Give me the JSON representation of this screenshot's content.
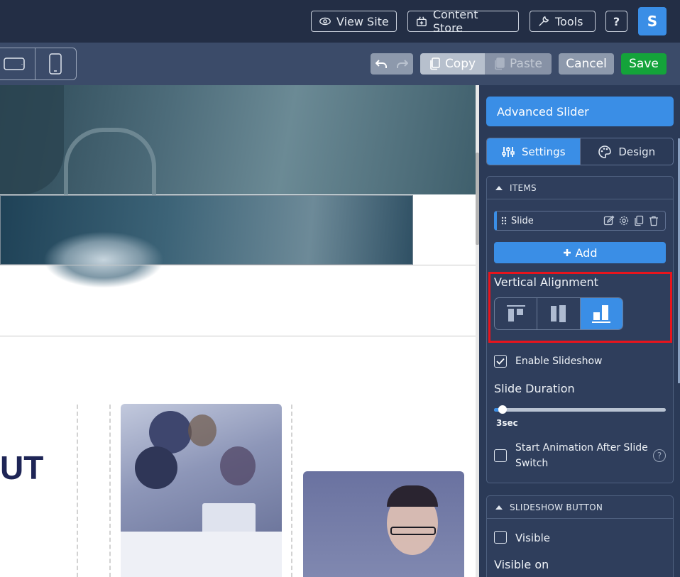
{
  "topbar": {
    "view_site": "View Site",
    "content_store": "Content Store",
    "tools": "Tools",
    "help": "?",
    "avatar_initial": "S"
  },
  "toolbar": {
    "copy": "Copy",
    "paste": "Paste",
    "cancel": "Cancel",
    "save": "Save"
  },
  "canvas": {
    "partial_heading": "UT"
  },
  "panel": {
    "title": "Advanced Slider",
    "tabs": [
      {
        "label": "Settings",
        "icon": "sliders-icon",
        "active": true
      },
      {
        "label": "Design",
        "icon": "palette-icon",
        "active": false
      }
    ],
    "items_section": {
      "header": "ITEMS",
      "items": [
        {
          "label": "Slide"
        }
      ],
      "add_label": "Add"
    },
    "vertical_alignment": {
      "label": "Vertical Alignment",
      "options": [
        "align-top-icon",
        "align-middle-icon",
        "align-bottom-icon"
      ],
      "selected": "align-bottom-icon"
    },
    "enable_slideshow": {
      "label": "Enable Slideshow",
      "checked": true
    },
    "slide_duration": {
      "label": "Slide Duration",
      "value_text": "3sec",
      "fraction": 0.03
    },
    "start_animation": {
      "label_line1": "Start Animation After Slide",
      "label_line2": "Switch",
      "checked": false
    },
    "slideshow_button": {
      "header": "SLIDESHOW BUTTON",
      "visible": {
        "label": "Visible",
        "checked": false
      },
      "visible_on": "Visible on"
    }
  },
  "colors": {
    "accent": "#3a8ee6",
    "save_green": "#14a33a",
    "highlight_red": "#e8141c"
  }
}
